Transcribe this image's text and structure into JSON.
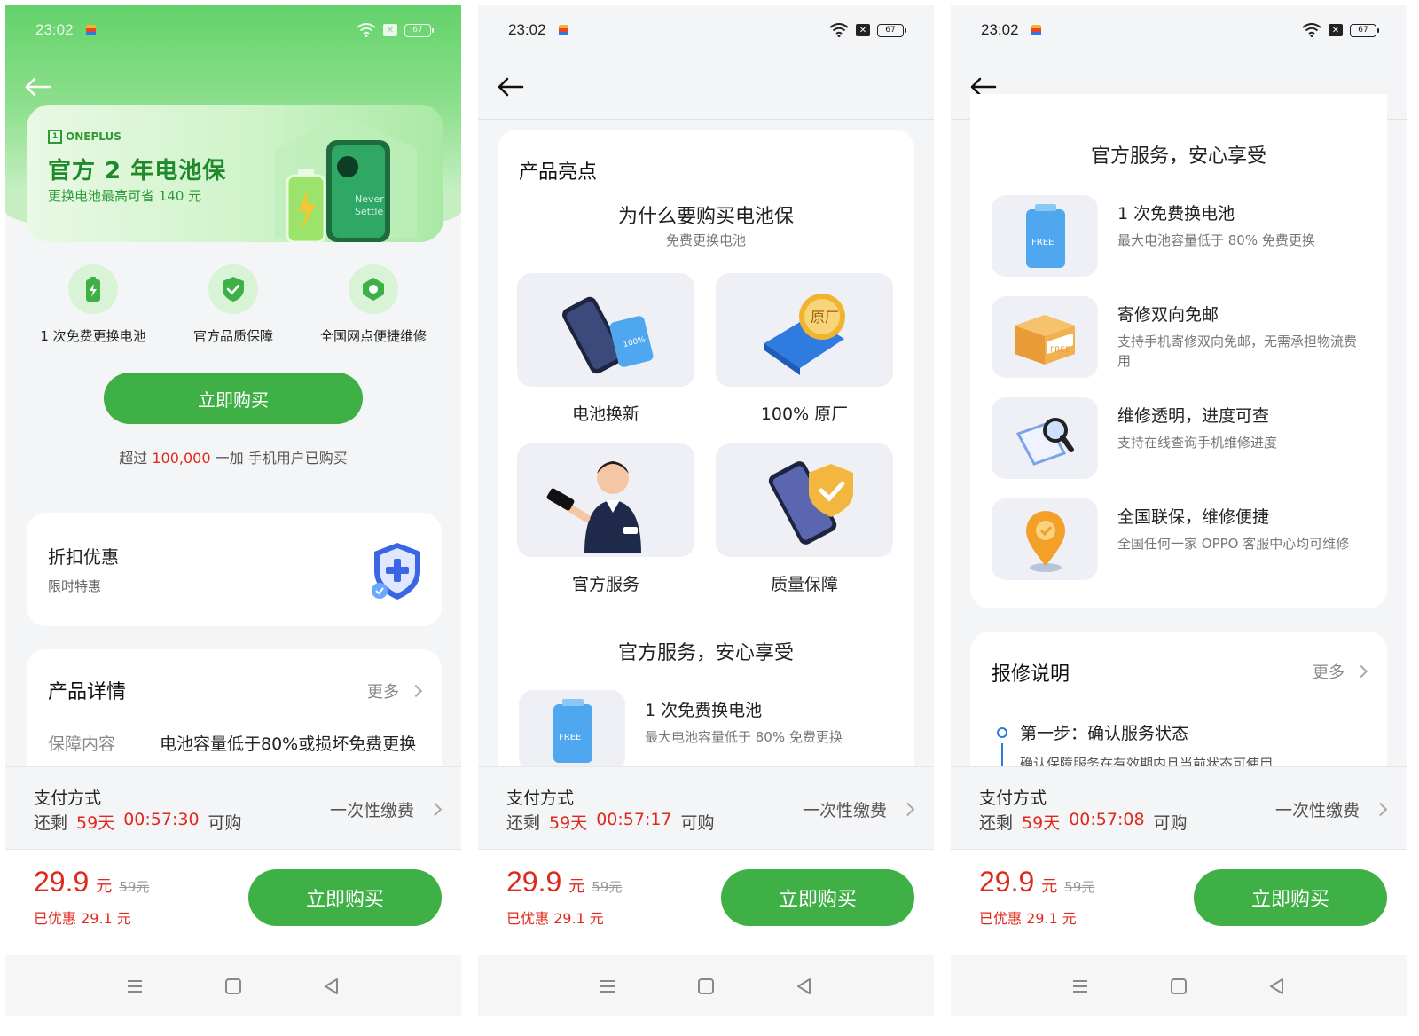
{
  "status": {
    "time": "23:02",
    "battery": "67"
  },
  "screen1": {
    "brand": "ONEPLUS",
    "hero_title": "官方 2 年电池保",
    "hero_sub": "更换电池最高可省 140 元",
    "hero_art_text": "Never Settle",
    "features": [
      {
        "label": "1 次免费更换电池",
        "icon": "battery-icon"
      },
      {
        "label": "官方品质保障",
        "icon": "shield-check-icon"
      },
      {
        "label": "全国网点便捷维修",
        "icon": "location-icon"
      }
    ],
    "buy_now": "立即购买",
    "sold_prefix": "超过",
    "sold_count": "100,000",
    "sold_suffix": "一加 手机用户已购买",
    "discount_title": "折扣优惠",
    "discount_sub": "限时特惠",
    "detail_title": "产品详情",
    "more": "更多",
    "detail_key": "保障内容",
    "detail_value": "电池容量低于80%或损坏免费更换"
  },
  "screen2": {
    "section_title": "产品亮点",
    "why_title": "为什么要购买电池保",
    "why_sub": "免费更换电池",
    "tiles": [
      {
        "label": "电池换新"
      },
      {
        "label": "100% 原厂",
        "art": "原厂"
      },
      {
        "label": "官方服务"
      },
      {
        "label": "质量保障"
      }
    ],
    "service_title": "官方服务，安心享受",
    "service_item_title": "1 次免费换电池",
    "service_item_desc": "最大电池容量低于 80% 免费更换"
  },
  "screen3": {
    "service_title": "官方服务，安心享受",
    "services": [
      {
        "title": "1 次免费换电池",
        "desc": "最大电池容量低于 80% 免费更换",
        "icon": "battery-free-icon"
      },
      {
        "title": "寄修双向免邮",
        "desc": "支持手机寄修双向免邮，无需承担物流费用",
        "icon": "box-free-icon"
      },
      {
        "title": "维修透明，进度可查",
        "desc": "支持在线查询手机维修进度",
        "icon": "magnifier-icon"
      },
      {
        "title": "全国联保，维修便捷",
        "desc": "全国任何一家 OPPO 客服中心均可维修",
        "icon": "location-pin-icon"
      }
    ],
    "repair_title": "报修说明",
    "more": "更多",
    "step_title": "第一步：确认服务状态",
    "step_desc": "确认保障服务在有效期内且当前状态可使用"
  },
  "payment": {
    "title": "支付方式",
    "remaining_label": "还剩",
    "days": "59天",
    "available": "可购",
    "timers": [
      "00:57:30",
      "00:57:17",
      "00:57:08"
    ],
    "method": "一次性缴费"
  },
  "bottom": {
    "price": "29.9",
    "unit": "元",
    "original": "59元",
    "saved": "已优惠 29.1 元",
    "buy": "立即购买"
  },
  "art_text": {
    "free": "FREE",
    "percent": "100%"
  },
  "colors": {
    "accent": "#3fb045",
    "price": "#e0281d",
    "step": "#2c7be5"
  }
}
